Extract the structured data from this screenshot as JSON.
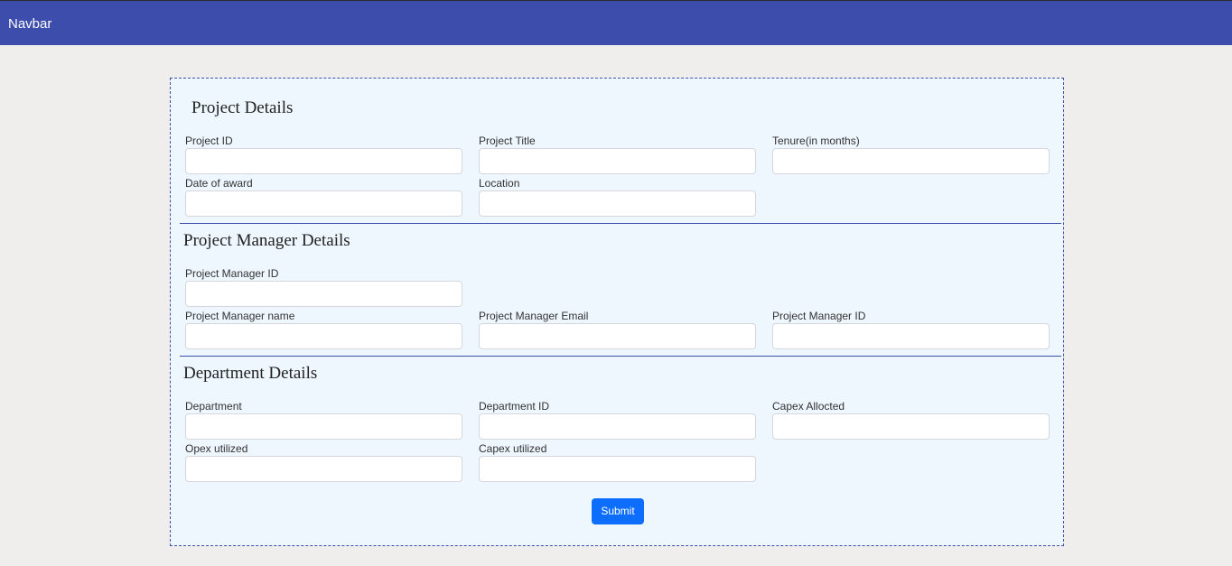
{
  "navbar": {
    "brand": "Navbar"
  },
  "colors": {
    "navbar_bg": "#3c4dab",
    "page_bg": "#efeeec",
    "card_bg": "#eef6fe",
    "accent": "#0d6efd"
  },
  "sections": {
    "project": {
      "title": "Project Details",
      "fields": {
        "project_id": {
          "label": "Project ID",
          "value": ""
        },
        "project_title": {
          "label": "Project Title",
          "value": ""
        },
        "tenure": {
          "label": "Tenure(in months)",
          "value": ""
        },
        "date_of_award": {
          "label": "Date of award",
          "value": ""
        },
        "location": {
          "label": "Location",
          "value": ""
        }
      }
    },
    "manager": {
      "title": "Project Manager Details",
      "fields": {
        "manager_id": {
          "label": "Project Manager ID",
          "value": ""
        },
        "manager_name": {
          "label": "Project Manager name",
          "value": ""
        },
        "manager_email": {
          "label": "Project Manager Email",
          "value": ""
        },
        "manager_id_2": {
          "label": "Project Manager ID",
          "value": ""
        }
      }
    },
    "department": {
      "title": "Department Details",
      "fields": {
        "department": {
          "label": "Department",
          "value": ""
        },
        "department_id": {
          "label": "Department ID",
          "value": ""
        },
        "capex_allocated": {
          "label": "Capex Allocted",
          "value": ""
        },
        "opex_utilized": {
          "label": "Opex utilized",
          "value": ""
        },
        "capex_utilized": {
          "label": "Capex utilized",
          "value": ""
        }
      }
    }
  },
  "submit": {
    "label": "Submit"
  }
}
